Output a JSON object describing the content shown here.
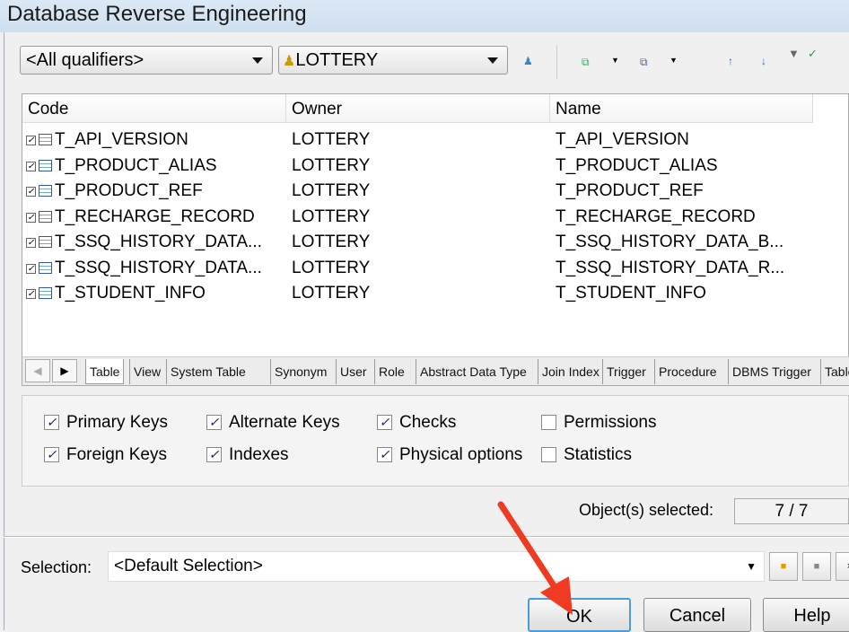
{
  "window": {
    "title": "Database Reverse Engineering"
  },
  "toolbar": {
    "qualifier": "<All qualifiers>",
    "owner": "LOTTERY",
    "icons": [
      "owner-icon",
      "select-all-icon",
      "deselect-all-icon",
      "move-up-icon",
      "move-down-icon",
      "filter-edit-icon",
      "filter-apply-icon"
    ]
  },
  "list": {
    "columns": [
      "Code",
      "Owner",
      "Name"
    ],
    "rows": [
      {
        "code": "T_API_VERSION",
        "owner": "LOTTERY",
        "name": "T_API_VERSION"
      },
      {
        "code": "T_PRODUCT_ALIAS",
        "owner": "LOTTERY",
        "name": "T_PRODUCT_ALIAS"
      },
      {
        "code": "T_PRODUCT_REF",
        "owner": "LOTTERY",
        "name": "T_PRODUCT_REF"
      },
      {
        "code": "T_RECHARGE_RECORD",
        "owner": "LOTTERY",
        "name": "T_RECHARGE_RECORD"
      },
      {
        "code": "T_SSQ_HISTORY_DATA...",
        "owner": "LOTTERY",
        "name": "T_SSQ_HISTORY_DATA_B..."
      },
      {
        "code": "T_SSQ_HISTORY_DATA...",
        "owner": "LOTTERY",
        "name": "T_SSQ_HISTORY_DATA_R..."
      },
      {
        "code": "T_STUDENT_INFO",
        "owner": "LOTTERY",
        "name": "T_STUDENT_INFO"
      }
    ]
  },
  "tabs": [
    "Table",
    "View",
    "System Table",
    "Synonym",
    "User",
    "Role",
    "Abstract Data Type",
    "Join Index",
    "Trigger",
    "Procedure",
    "DBMS Trigger",
    "Tablespa"
  ],
  "options": [
    {
      "label": "Primary Keys",
      "checked": true
    },
    {
      "label": "Alternate Keys",
      "checked": true
    },
    {
      "label": "Checks",
      "checked": true
    },
    {
      "label": "Permissions",
      "checked": false
    },
    {
      "label": "Foreign Keys",
      "checked": true
    },
    {
      "label": "Indexes",
      "checked": true
    },
    {
      "label": "Physical options",
      "checked": true
    },
    {
      "label": "Statistics",
      "checked": false
    }
  ],
  "status": {
    "label": "Object(s) selected:",
    "value": "7 / 7"
  },
  "selection": {
    "label": "Selection:",
    "value": "<Default Selection>"
  },
  "buttons": {
    "ok": "OK",
    "cancel": "Cancel",
    "help": "Help"
  },
  "annotation": {
    "arrow_color": "#f03a22"
  }
}
